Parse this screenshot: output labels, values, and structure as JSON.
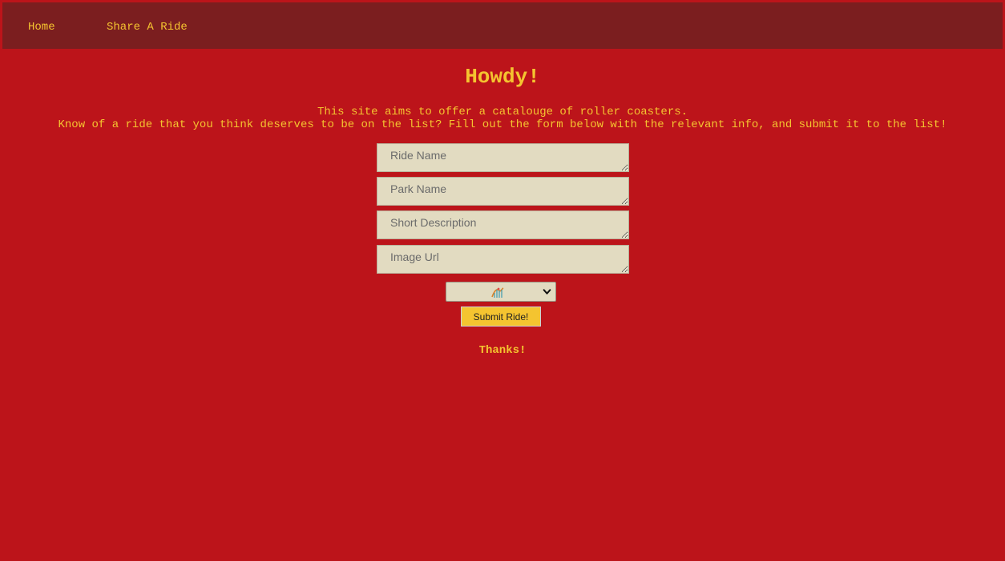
{
  "nav": {
    "home_label": "Home",
    "share_label": "Share A Ride"
  },
  "main": {
    "heading": "Howdy!",
    "intro_line1": "This site aims to offer a catalouge of roller coasters.",
    "intro_line2": "Know of a ride that you think deserves to be on the list? Fill out the form below with the relevant info, and submit it to the list!"
  },
  "form": {
    "ride_name_placeholder": "Ride Name",
    "park_name_placeholder": "Park Name",
    "description_placeholder": "Short Description",
    "image_url_placeholder": "Image Url",
    "select_icon": "roller-coaster-icon",
    "submit_label": "Submit Ride!",
    "thanks_text": "Thanks!"
  },
  "colors": {
    "background": "#bc141a",
    "topbar": "#7b1e1f",
    "accent_text": "#f4c430",
    "field_background": "#e2dbc1",
    "button": "#f4c430"
  }
}
